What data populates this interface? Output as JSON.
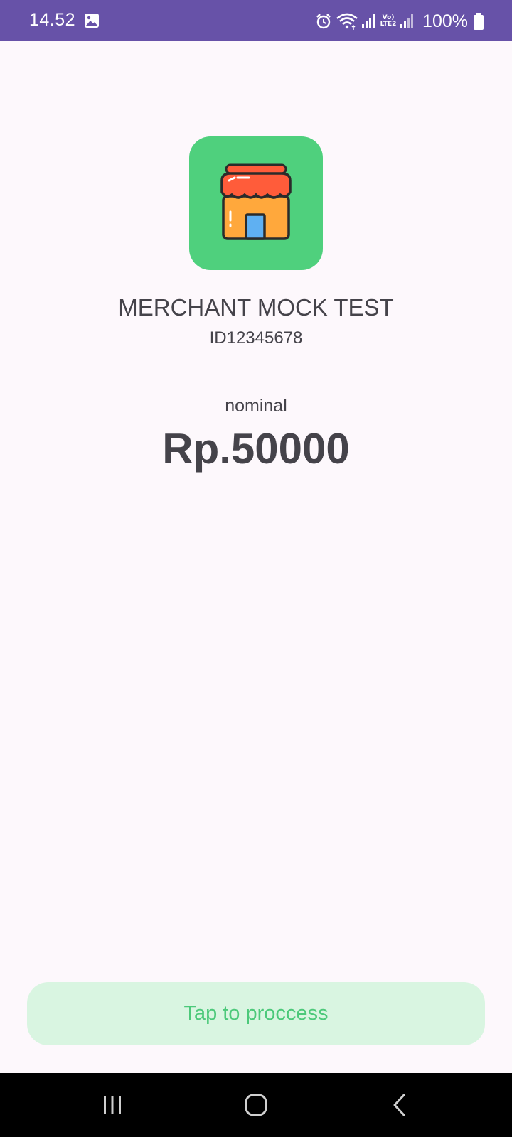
{
  "status_bar": {
    "time": "14.52",
    "battery_percent": "100%",
    "network_badge": "Vo) LTE2",
    "icons": [
      "gallery-icon",
      "alarm-icon",
      "wifi-icon",
      "signal-icon",
      "signal-icon-2",
      "battery-icon"
    ],
    "background_color": "#6752a8"
  },
  "merchant": {
    "logo_icon": "store-icon",
    "logo_background": "#4fd07d",
    "name": "MERCHANT MOCK TEST",
    "id": "ID12345678"
  },
  "payment": {
    "label": "nominal",
    "amount": "Rp.50000"
  },
  "action": {
    "button_label": "Tap to proccess",
    "button_color": "#d9f5e1",
    "text_color": "#4cc97a"
  },
  "nav_bar": {
    "icons": [
      "recents-icon",
      "home-icon",
      "back-icon"
    ]
  }
}
